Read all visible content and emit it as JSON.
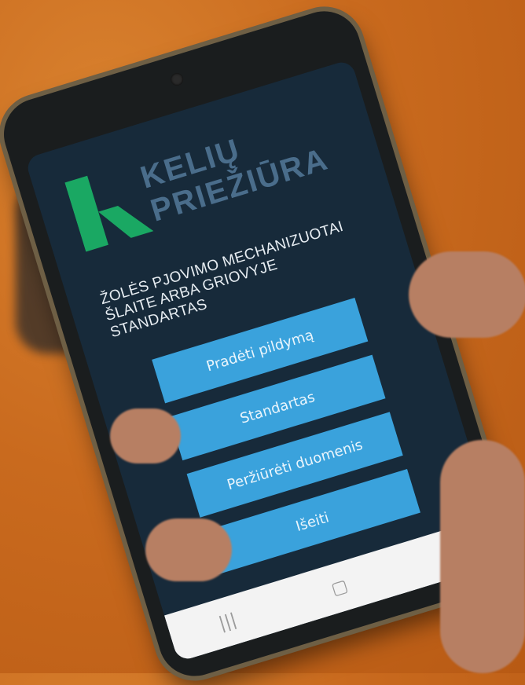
{
  "app": {
    "logo_line1": "KELIŲ",
    "logo_line2": "PRIEŽIŪRA",
    "title_lines": [
      "ŽOLĖS PJOVIMO MECHANIZUOTAI",
      "ŠLAITE ARBA GRIOVYJE",
      "STANDARTAS"
    ],
    "buttons": [
      "Pradėti pildymą",
      "Standartas",
      "Peržiūrėti duomenis",
      "Išeiti"
    ]
  },
  "navbar": {
    "icons": [
      "recent-apps-icon",
      "home-icon",
      "back-icon"
    ],
    "glyphs": [
      "|||",
      "▢",
      "‹"
    ]
  },
  "colors": {
    "screen_bg": "#172a3a",
    "button_bg": "#3aa2dc",
    "logo_green": "#1aa863",
    "logo_text": "#4a6d8b"
  }
}
